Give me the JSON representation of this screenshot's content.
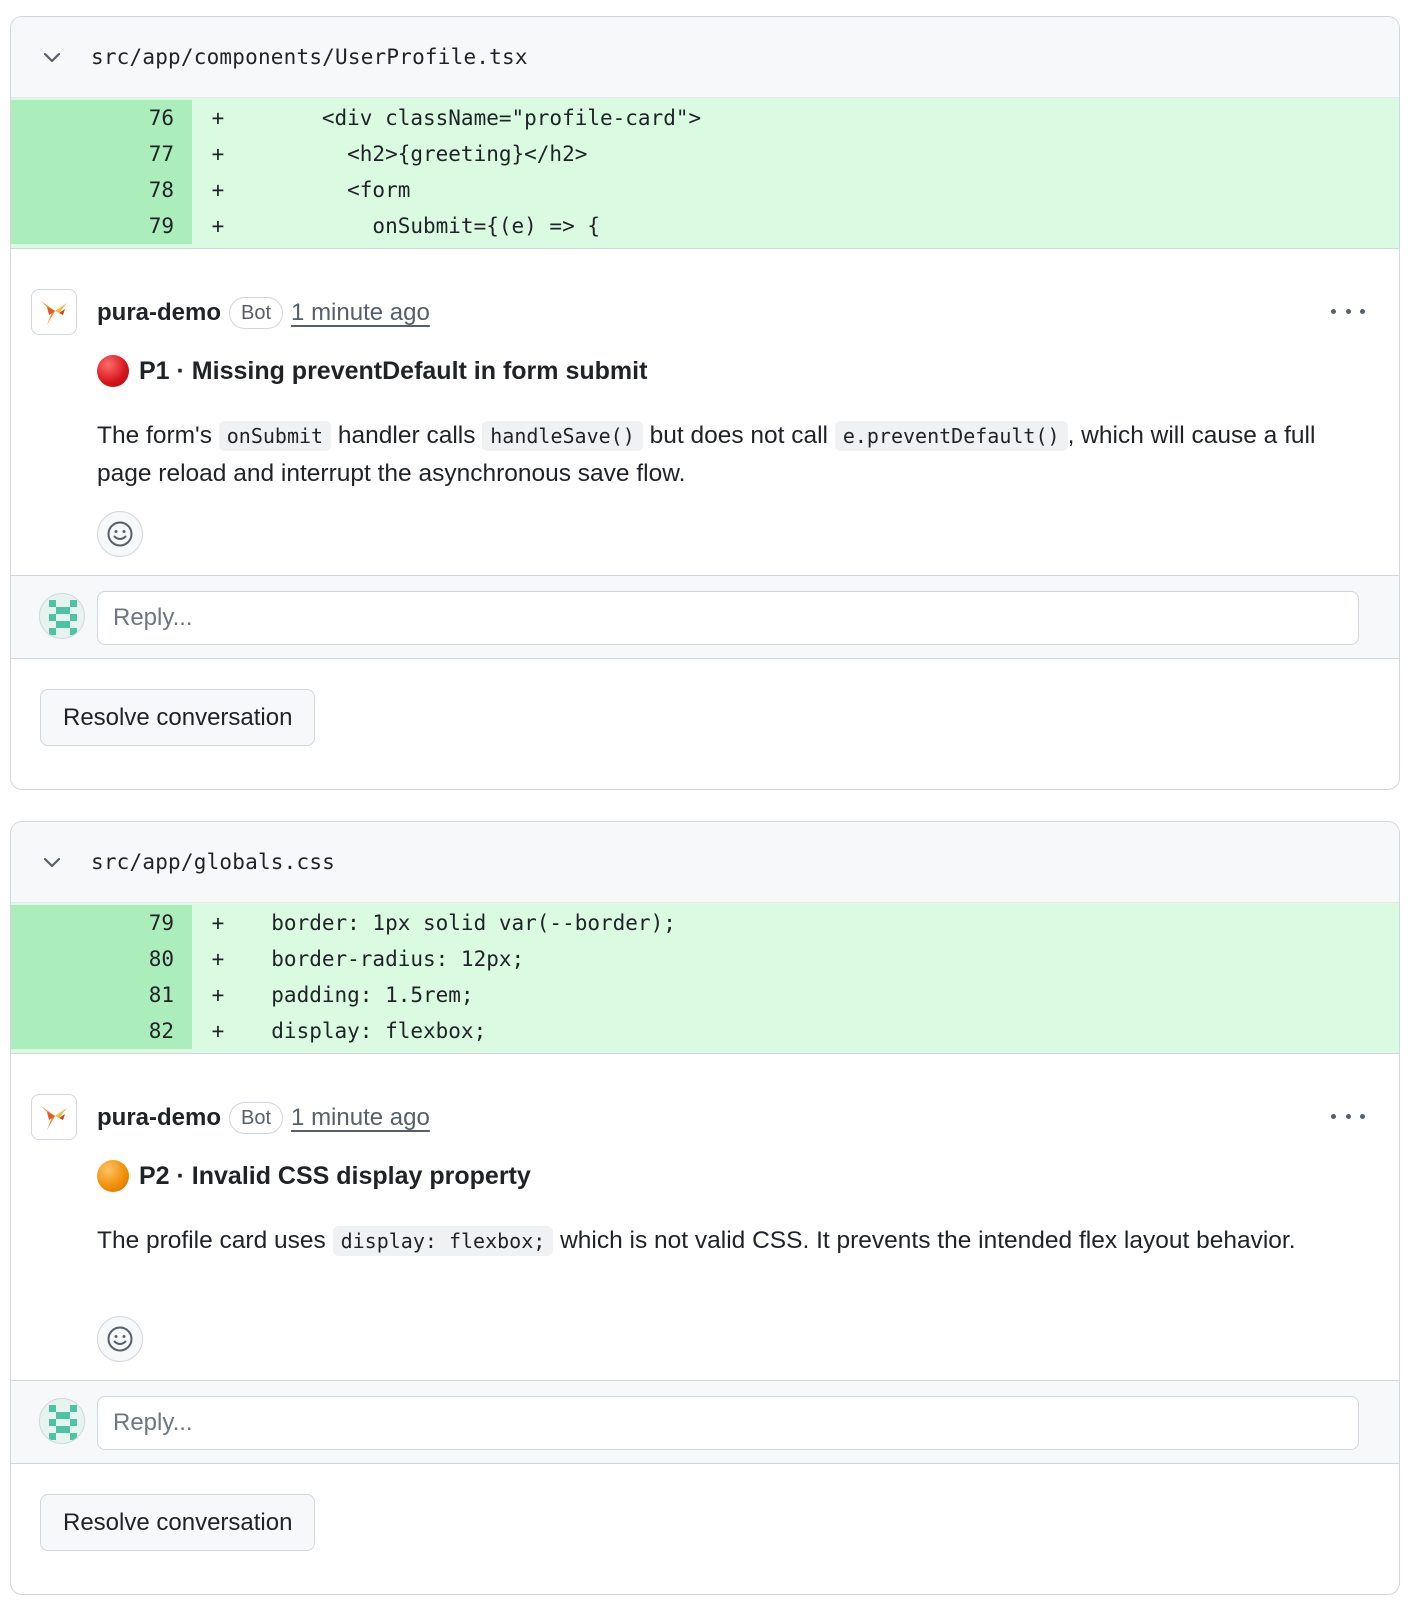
{
  "threads": [
    {
      "file_path": "src/app/components/UserProfile.tsx",
      "diff": [
        {
          "line": "76",
          "sign": "+",
          "code": "      <div className=\"profile-card\">"
        },
        {
          "line": "77",
          "sign": "+",
          "code": "        <h2>{greeting}</h2>"
        },
        {
          "line": "78",
          "sign": "+",
          "code": "        <form"
        },
        {
          "line": "79",
          "sign": "+",
          "code": "          onSubmit={(e) => {"
        }
      ],
      "comment": {
        "author": "pura-demo",
        "badge": "Bot",
        "time": "1 minute ago",
        "severity_color": "#d4141b",
        "title": "P1 · Missing preventDefault in form submit",
        "body": {
          "t1": "The form's ",
          "c1": "onSubmit",
          "t2": " handler calls ",
          "c2": "handleSave()",
          "t3": " but does not call ",
          "c3": "e.preventDefault()",
          "t4": ", which will cause a full page reload and interrupt the asynchronous save flow."
        }
      },
      "reply_placeholder": "Reply...",
      "resolve_label": "Resolve conversation"
    },
    {
      "file_path": "src/app/globals.css",
      "diff": [
        {
          "line": "79",
          "sign": "+",
          "code": "  border: 1px solid var(--border);"
        },
        {
          "line": "80",
          "sign": "+",
          "code": "  border-radius: 12px;"
        },
        {
          "line": "81",
          "sign": "+",
          "code": "  padding: 1.5rem;"
        },
        {
          "line": "82",
          "sign": "+",
          "code": "  display: flexbox;"
        }
      ],
      "comment": {
        "author": "pura-demo",
        "badge": "Bot",
        "time": "1 minute ago",
        "severity_color": "#f08c00",
        "title": "P2 · Invalid CSS display property",
        "body": {
          "t1": "The profile card uses ",
          "c1": "display: flexbox;",
          "t2": " which is not valid CSS. It prevents the intended flex layout behavior."
        }
      },
      "reply_placeholder": "Reply...",
      "resolve_label": "Resolve conversation"
    }
  ],
  "icons": {
    "collapse": "chevron-down-icon",
    "bot_avatar": "bird-logo-icon",
    "more": "kebab-horizontal-icon",
    "reaction": "smiley-icon",
    "user_avatar": "identicon-icon"
  }
}
